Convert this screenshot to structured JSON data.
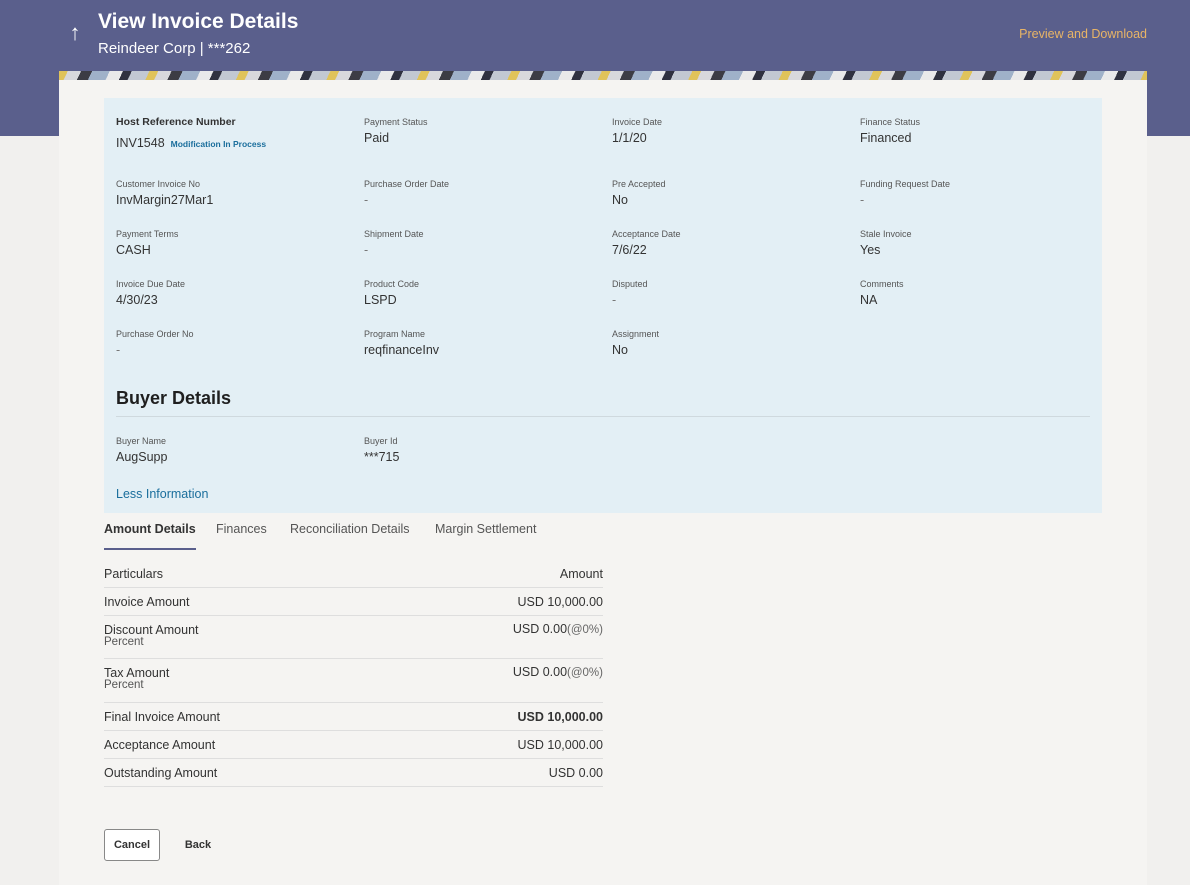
{
  "header": {
    "title": "View Invoice Details",
    "subtitle": "Reindeer Corp | ***262",
    "back_icon": "arrow-up-icon",
    "preview_link": "Preview and Download"
  },
  "invoice": {
    "host_ref": {
      "label": "Host Reference Number",
      "value": "INV1548",
      "status_link": "Modification In Process"
    },
    "payment_status": {
      "label": "Payment Status",
      "value": "Paid"
    },
    "invoice_date": {
      "label": "Invoice Date",
      "value": "1/1/20"
    },
    "finance_status": {
      "label": "Finance Status",
      "value": "Financed"
    },
    "customer_invoice_no": {
      "label": "Customer Invoice No",
      "value": "InvMargin27Mar1"
    },
    "purchase_order_date": {
      "label": "Purchase Order Date",
      "value": "-"
    },
    "pre_accepted": {
      "label": "Pre Accepted",
      "value": "No"
    },
    "funding_request_date": {
      "label": "Funding Request Date",
      "value": "-"
    },
    "payment_terms": {
      "label": "Payment Terms",
      "value": "CASH"
    },
    "shipment_date": {
      "label": "Shipment Date",
      "value": "-"
    },
    "acceptance_date": {
      "label": "Acceptance Date",
      "value": "7/6/22"
    },
    "stale_invoice": {
      "label": "Stale Invoice",
      "value": "Yes"
    },
    "invoice_due_date": {
      "label": "Invoice Due Date",
      "value": "4/30/23"
    },
    "product_code": {
      "label": "Product Code",
      "value": "LSPD"
    },
    "disputed": {
      "label": "Disputed",
      "value": "-"
    },
    "comments": {
      "label": "Comments",
      "value": "NA"
    },
    "purchase_order_no": {
      "label": "Purchase Order No",
      "value": "-"
    },
    "program_name": {
      "label": "Program Name",
      "value": "reqfinanceInv"
    },
    "assignment": {
      "label": "Assignment",
      "value": "No"
    }
  },
  "buyer": {
    "title": "Buyer Details",
    "buyer_name": {
      "label": "Buyer Name",
      "value": "AugSupp"
    },
    "buyer_id": {
      "label": "Buyer Id",
      "value": "***715"
    },
    "less_info": "Less Information"
  },
  "tabs": [
    "Amount Details",
    "Finances",
    "Reconciliation Details",
    "Margin Settlement"
  ],
  "amounts": {
    "header": {
      "particulars": "Particulars",
      "amount": "Amount"
    },
    "rows": [
      {
        "label": "Invoice Amount",
        "value": "USD 10,000.00"
      },
      {
        "label": "Discount Amount",
        "sub": "Percent",
        "value": "USD 0.00",
        "pct": "(@0%)"
      },
      {
        "label": "Tax Amount",
        "sub": "Percent",
        "value": "USD 0.00",
        "pct": "(@0%)"
      },
      {
        "label": "Final Invoice Amount",
        "value": "USD 10,000.00"
      },
      {
        "label": "Acceptance Amount",
        "value": "USD 10,000.00"
      },
      {
        "label": "Outstanding Amount",
        "value": "USD 0.00"
      }
    ]
  },
  "buttons": {
    "cancel": "Cancel",
    "back": "Back"
  }
}
